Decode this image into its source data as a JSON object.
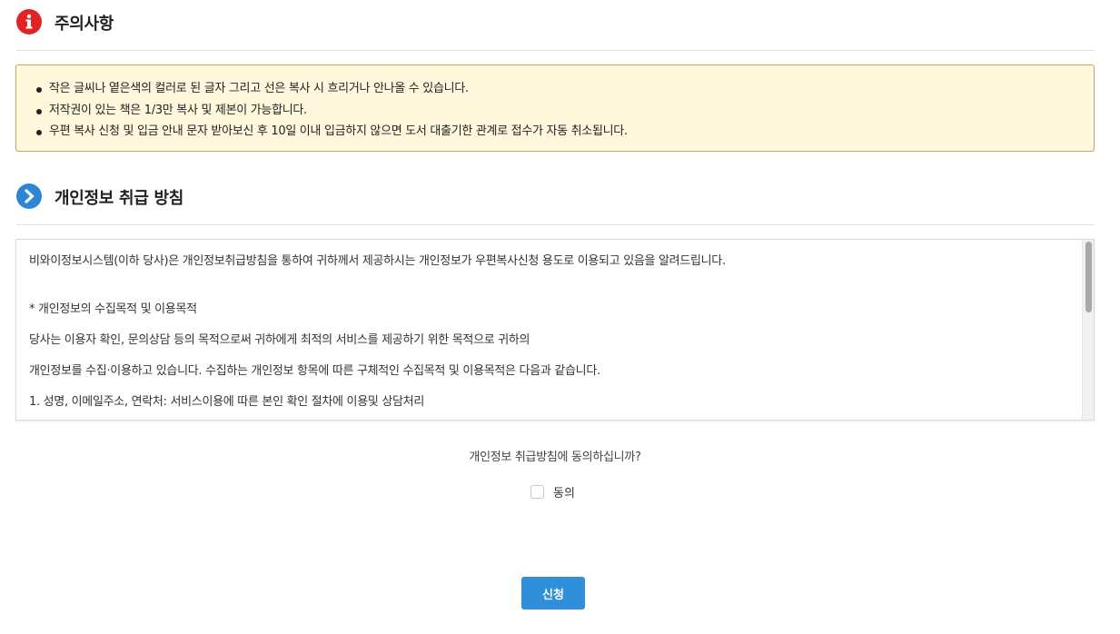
{
  "notice": {
    "title": "주의사항",
    "icon": "info-icon",
    "icon_color": "#e02424",
    "items": [
      "작은 글씨나 옅은색의 컬러로 된 글자 그리고 선은 복사 시 흐리거나 안나올 수 있습니다.",
      "저작권이 있는 책은 1/3만 복사 및 제본이 가능합니다.",
      "우편 복사 신청 및 입금 안내 문자 받아보신 후 10일 이내 입금하지 않으면 도서 대출기한 관계로 접수가 자동 취소됩니다."
    ]
  },
  "privacy": {
    "title": "개인정보 취급 방침",
    "icon": "chevron-right-circle-icon",
    "icon_color": "#2b87d6",
    "lines": [
      "비와이정보시스템(이하 당사)은 개인정보취급방침을 통하여 귀하께서 제공하시는 개인정보가 우편복사신청 용도로 이용되고 있음을 알려드립니다.",
      "* 개인정보의 수집목적 및 이용목적",
      "당사는 이용자 확인, 문의상담 등의 목적으로써 귀하에게 최적의 서비스를 제공하기 위한 목적으로 귀하의",
      "개인정보를 수집·이용하고 있습니다. 수집하는 개인정보 항목에 따른 구체적인 수집목적 및 이용목적은 다음과 같습니다.",
      "1. 성명, 이메일주소, 연락처: 서비스이용에 따른 본인 확인 절차에 이용및 상담처리"
    ]
  },
  "agreement": {
    "question": "개인정보 취급방침에 동의하십니까?",
    "checkbox_label": "동의",
    "checked": false
  },
  "submit": {
    "label": "신청",
    "color": "#2f8fd8"
  }
}
